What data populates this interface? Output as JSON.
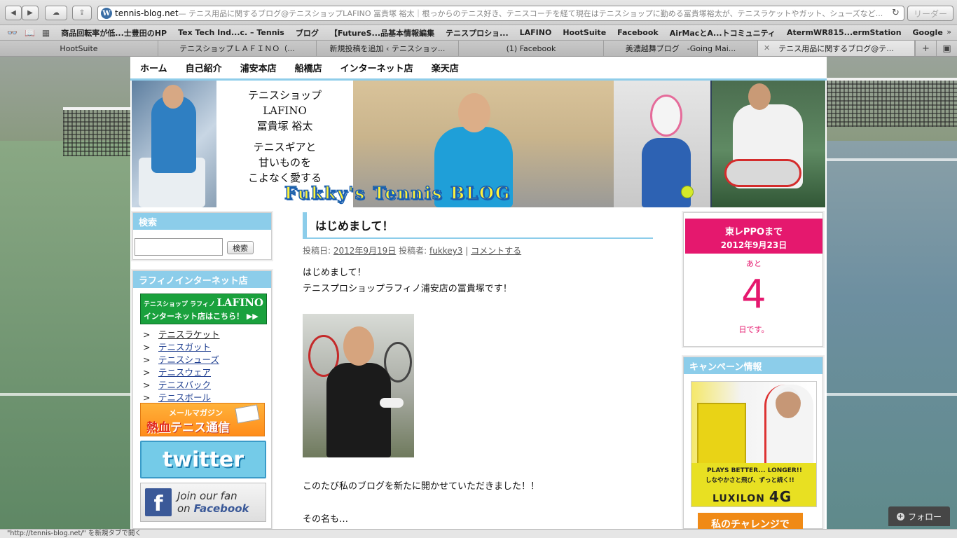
{
  "browser": {
    "url_host": "tennis-blog.net",
    "url_title": " — テニス用品に関するブログ@テニスショップLAFINO 冨貴塚 裕太｜根っからのテニス好き、テニスコーチを経て現在はテニスショップに勤める冨貴塚裕太が、テニスラケットやガット、シューズなど...",
    "reader_label": "リーダー",
    "bookmarks": [
      "商品回転率が低...士豊田のHP",
      "Tex Tech Ind...c. – Tennis",
      "ブログ",
      "【FutureS...品基本情報編集",
      "テニスプロショ...",
      "LAFINO",
      "HootSuite",
      "Facebook",
      "AirMacとA...トコミュニティ",
      "AtermWR815...ermStation",
      "Google"
    ],
    "bookmarks_more": "»",
    "tabs": [
      "HootSuite",
      "テニスショップＬＡＦＩＮＯ（...",
      "新規投稿を追加 ‹ テニスショッ...",
      "(1) Facebook",
      "美濃越舞ブログ　-Going Mai...",
      "テニス用品に関するブログ@テ..."
    ],
    "status_text": "\"http://tennis-blog.net/\" を新規タブで開く"
  },
  "nav": {
    "items": [
      "ホーム",
      "自己紹介",
      "浦安本店",
      "船橋店",
      "インターネット店",
      "楽天店"
    ]
  },
  "header": {
    "lines": [
      "テニスショップ",
      "LAFINO",
      "冨貴塚 裕太",
      "テニスギアと",
      "甘いものを",
      "こよなく愛する"
    ],
    "banner": "Fukky's Tennis BLOG"
  },
  "sidebar_left": {
    "search_title": "検索",
    "search_button": "検索",
    "search_value": "",
    "shop_title": "ラフィノインターネット店",
    "lafino_banner_top": "テニスショップ ラフィノ",
    "lafino_banner_brand": "LAFINO",
    "lafino_banner_sub": "インターネット店はこちら！ ▶▶",
    "links": [
      "テニスラケット",
      "テニスガット",
      "テニスシューズ",
      "テニスウェア",
      "テニスバック",
      "テニスボール"
    ],
    "arrow": ">",
    "mail_top": "メールマガジン",
    "mail_main_red": "熱血",
    "mail_main": "テニス通信",
    "twitter_label": "twitter",
    "fb_line1": "Join our fan",
    "fb_on": "on ",
    "fb_brand": "Facebook",
    "fb_letter": "f"
  },
  "post": {
    "title": "はじめまして！",
    "meta_posted": "投稿日: ",
    "meta_date": "2012年9月19日",
    "meta_by": " 投稿者: ",
    "meta_author": "fukkey3",
    "meta_sep": " | ",
    "meta_comment": "コメントする",
    "p1": "はじめまして！",
    "p2": "テニスプロショップラフィノ浦安店の冨貴塚です！",
    "p3": "このたび私のブログを新たに開かせていただきました！！",
    "p4": "その名も…"
  },
  "sidebar_right": {
    "count_title": "東レPPOまで",
    "count_date": "2012年9月23日",
    "count_prefix": "あと",
    "count_number": "4",
    "count_suffix": "日です。",
    "campaign_title": "キャンペーン情報",
    "ad_line1": "PLAYS BETTER... LONGER!!",
    "ad_line2": "しなやかさと飛び、ずっと続く!!",
    "ad_brand": "LUXILON",
    "ad_model": "4G",
    "challenge": "私のチャレンジで"
  },
  "follow_label": "フォロー",
  "colors": {
    "accent_blue": "#8ccdea",
    "count_pink": "#e5186e",
    "facebook_blue": "#3b5998"
  }
}
